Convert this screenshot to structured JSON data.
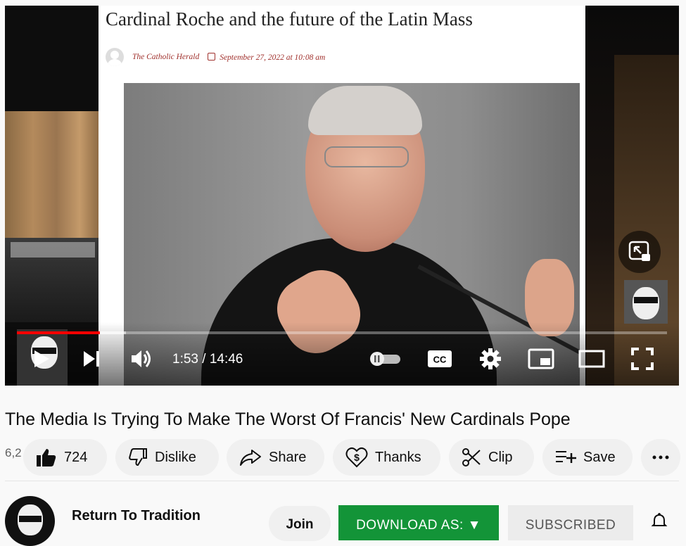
{
  "video": {
    "article_title": "Cardinal Roche and the future of the Latin Mass",
    "article_author": "The Catholic Herald",
    "article_date": "September 27, 2022 at 10:08 am",
    "time_display": "1:53 / 14:46",
    "progress_fraction": 0.128,
    "buffer_fraction": 0.168
  },
  "controls": {
    "play": "play-icon",
    "next": "next-icon",
    "volume": "volume-icon",
    "autoplay_toggle": "pause-toggle-icon",
    "captions_label": "CC",
    "settings": "gear-icon",
    "miniplayer": "miniplayer-icon",
    "theater": "theater-icon",
    "fullscreen": "fullscreen-icon"
  },
  "title": "The Media Is Trying To Make The Worst Of Francis' New Cardinals Pope",
  "views_stub": "6,2",
  "actions": {
    "like_count": "724",
    "dislike_label": "Dislike",
    "share_label": "Share",
    "thanks_label": "Thanks",
    "clip_label": "Clip",
    "save_label": "Save"
  },
  "channel": {
    "name": "Return To Tradition",
    "join_label": "Join",
    "download_label": "DOWNLOAD AS: ▼",
    "subscribed_label": "SUBSCRIBED"
  },
  "colors": {
    "progress": "#ff0000",
    "download_bg": "#139438",
    "article_meta": "#a0302c"
  }
}
